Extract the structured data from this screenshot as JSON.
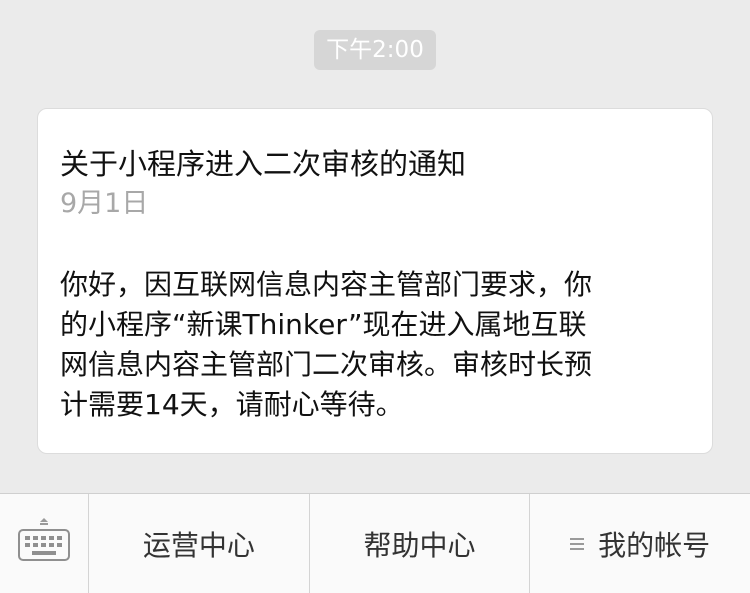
{
  "timestamp": "下午2:00",
  "message": {
    "title": "关于小程序进入二次审核的通知",
    "date": "9月1日",
    "body_lines": [
      "你好，因互联网信息内容主管部门要求，你",
      "的小程序“新课Thinker”现在进入属地互联",
      "网信息内容主管部门二次审核。审核时长预",
      "计需要14天，请耐心等待。"
    ]
  },
  "menu": {
    "keyboard_icon": "keyboard-icon",
    "items": [
      {
        "label": "运营中心"
      },
      {
        "label": "帮助中心"
      },
      {
        "label": "我的帐号",
        "icon": "submenu-lines-icon"
      }
    ]
  },
  "colors": {
    "background": "#ebebeb",
    "card": "#ffffff",
    "date_gray": "#a8a8a8",
    "timestamp_bg": "#d6d6d6"
  }
}
